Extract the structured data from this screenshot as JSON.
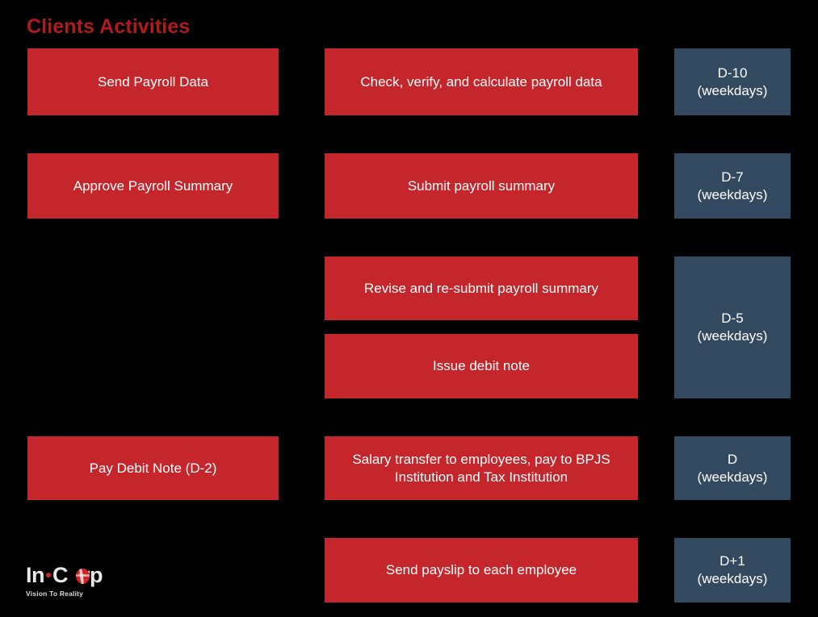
{
  "slide": {
    "title": "Clients Activities",
    "background_color": "#000000",
    "title_color": "#B01B1B",
    "accent_red": "#C4262B",
    "accent_blue": "#33495F",
    "text_color": "#FFFFFF"
  },
  "rows": [
    {
      "client_activity": "Send Payroll Data",
      "service_activities": [
        "Check, verify, and calculate payroll data"
      ],
      "timing": "D-10\n(weekdays)"
    },
    {
      "client_activity": "Approve Payroll Summary",
      "service_activities": [
        "Submit payroll summary"
      ],
      "timing": "D-7\n(weekdays)"
    },
    {
      "client_activity": "",
      "service_activities": [
        "Revise and re-submit payroll summary",
        "Issue debit note"
      ],
      "timing": "D-5\n(weekdays)"
    },
    {
      "client_activity": "Pay Debit Note (D-2)",
      "service_activities": [
        "Salary transfer to employees, pay to BPJS Institution and Tax Institution"
      ],
      "timing": "D\n(weekdays)"
    },
    {
      "client_activity": "",
      "service_activities": [
        "Send payslip to each employee"
      ],
      "timing": "D+1\n(weekdays)"
    }
  ],
  "logo": {
    "prefix": "In",
    "mid": "C",
    "suffix": "rp",
    "tagline": "Vision To Reality",
    "dot_color": "#D32128",
    "globe_color": "#D32128"
  }
}
